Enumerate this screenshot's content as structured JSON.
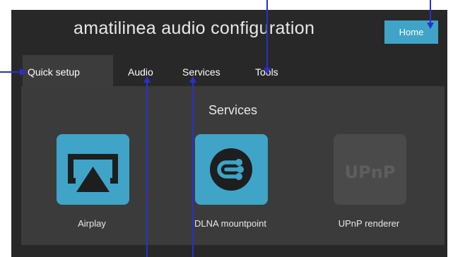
{
  "header": {
    "title": "amatilinea audio configuration",
    "home_label": "Home"
  },
  "tabs": [
    {
      "label": "Quick setup",
      "active": true
    },
    {
      "label": "Audio",
      "active": false
    },
    {
      "label": "Services",
      "active": false
    },
    {
      "label": "Tools",
      "active": false
    }
  ],
  "panel": {
    "title": "Services",
    "services": [
      {
        "label": "Airplay",
        "icon": "airplay-icon",
        "enabled": true
      },
      {
        "label": "DLNA mountpoint",
        "icon": "dlna-icon",
        "enabled": true
      },
      {
        "label": "UPnP renderer",
        "icon": "upnp-icon",
        "enabled": false
      }
    ]
  },
  "colors": {
    "accent": "#3fa4c7",
    "disabled_tile": "#4a4a4a",
    "background": "#282828",
    "panel": "#3b3b3b"
  }
}
